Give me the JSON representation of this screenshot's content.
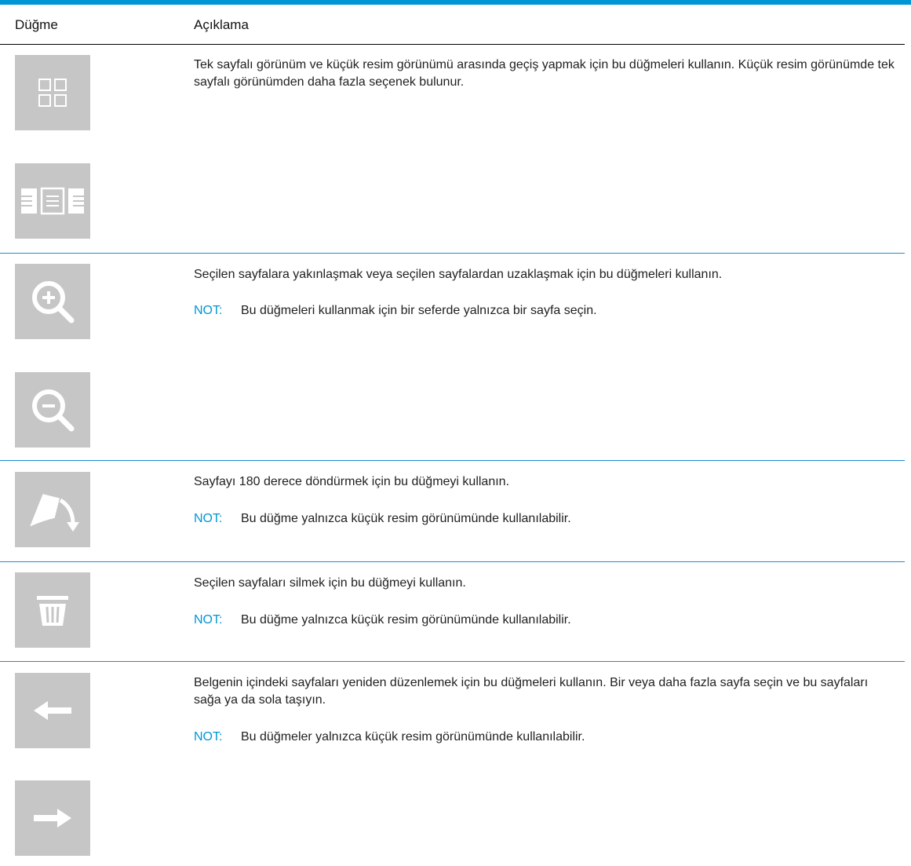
{
  "table": {
    "col_button": "Düğme",
    "col_description": "Açıklama"
  },
  "rows": [
    {
      "buttons": [
        "thumbnail-view-icon",
        "single-page-view-icon"
      ],
      "description": "Tek sayfalı görünüm ve küçük resim görünümü arasında geçiş yapmak için bu düğmeleri kullanın. Küçük resim görünümde tek sayfalı görünümden daha fazla seçenek bulunur.",
      "note_label": "",
      "note": ""
    },
    {
      "buttons": [
        "zoom-in-icon",
        "zoom-out-icon"
      ],
      "description": "Seçilen sayfalara yakınlaşmak veya seçilen sayfalardan uzaklaşmak için bu düğmeleri kullanın.",
      "note_label": "NOT:",
      "note": "Bu düğmeleri kullanmak için bir seferde yalnızca bir sayfa seçin."
    },
    {
      "buttons": [
        "rotate-page-icon"
      ],
      "description": "Sayfayı 180 derece döndürmek için bu düğmeyi kullanın.",
      "note_label": "NOT:",
      "note": "Bu düğme yalnızca küçük resim görünümünde kullanılabilir."
    },
    {
      "buttons": [
        "trash-icon"
      ],
      "description": "Seçilen sayfaları silmek için bu düğmeyi kullanın.",
      "note_label": "NOT:",
      "note": "Bu düğme yalnızca küçük resim görünümünde kullanılabilir."
    },
    {
      "buttons": [
        "arrow-left-icon",
        "arrow-right-icon"
      ],
      "description": "Belgenin içindeki sayfaları yeniden düzenlemek için bu düğmeleri kullanın. Bir veya daha fazla sayfa seçin ve bu sayfaları sağa ya da sola taşıyın.",
      "note_label": "NOT:",
      "note": "Bu düğmeler yalnızca küçük resim görünümünde kullanılabilir."
    }
  ],
  "colors": {
    "accent": "#0096d6",
    "button_bg": "#c6c6c6",
    "icon": "#ffffff"
  }
}
